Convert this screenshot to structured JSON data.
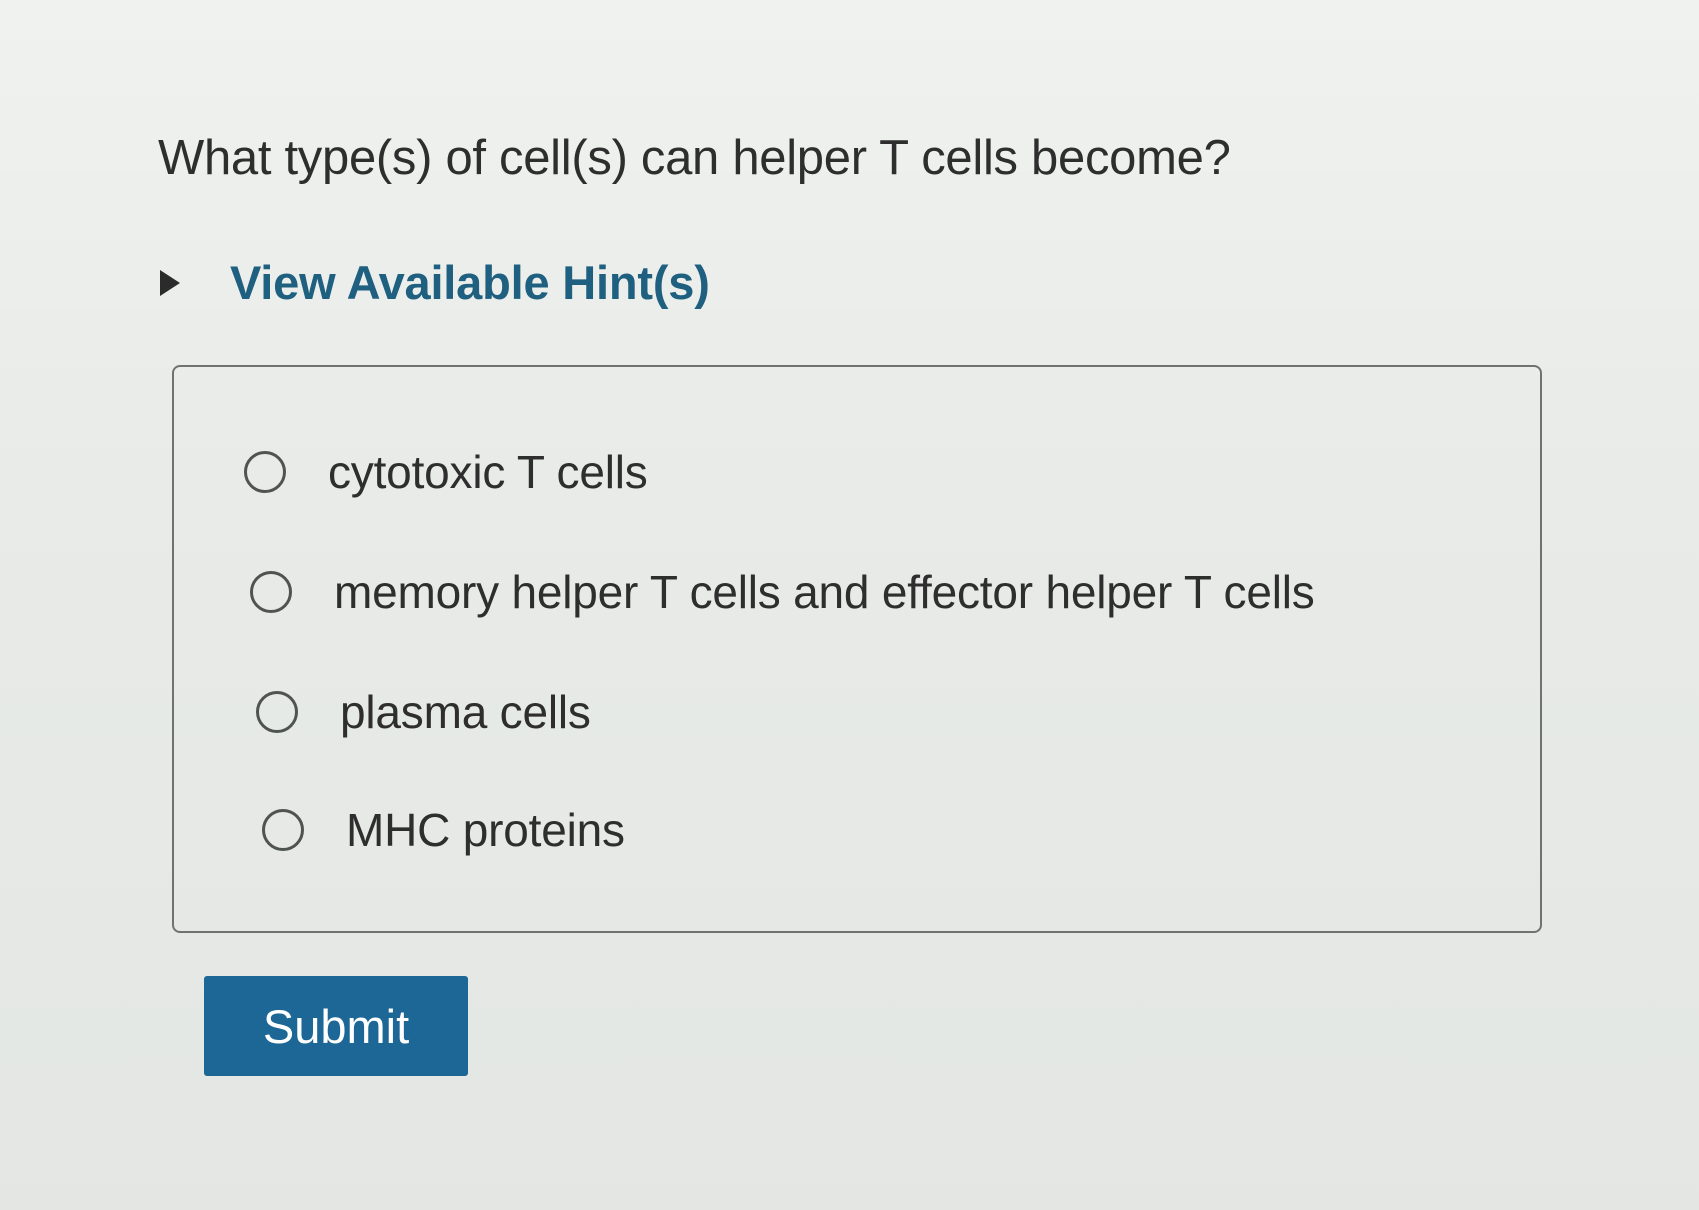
{
  "question": {
    "text": "What type(s) of cell(s) can helper T cells become?"
  },
  "hints": {
    "toggle_label": "View Available Hint(s)",
    "toggle_icon": "caret-right-icon"
  },
  "choices": [
    {
      "label": "cytotoxic T cells",
      "selected": false
    },
    {
      "label": "memory helper T cells and effector helper T cells",
      "selected": false
    },
    {
      "label": "plasma cells",
      "selected": false
    },
    {
      "label": "MHC proteins",
      "selected": false
    }
  ],
  "submit": {
    "label": "Submit"
  },
  "colors": {
    "hint_link": "#1f5f7f",
    "submit_bg": "#1c6796",
    "text": "#2e2e2e"
  }
}
